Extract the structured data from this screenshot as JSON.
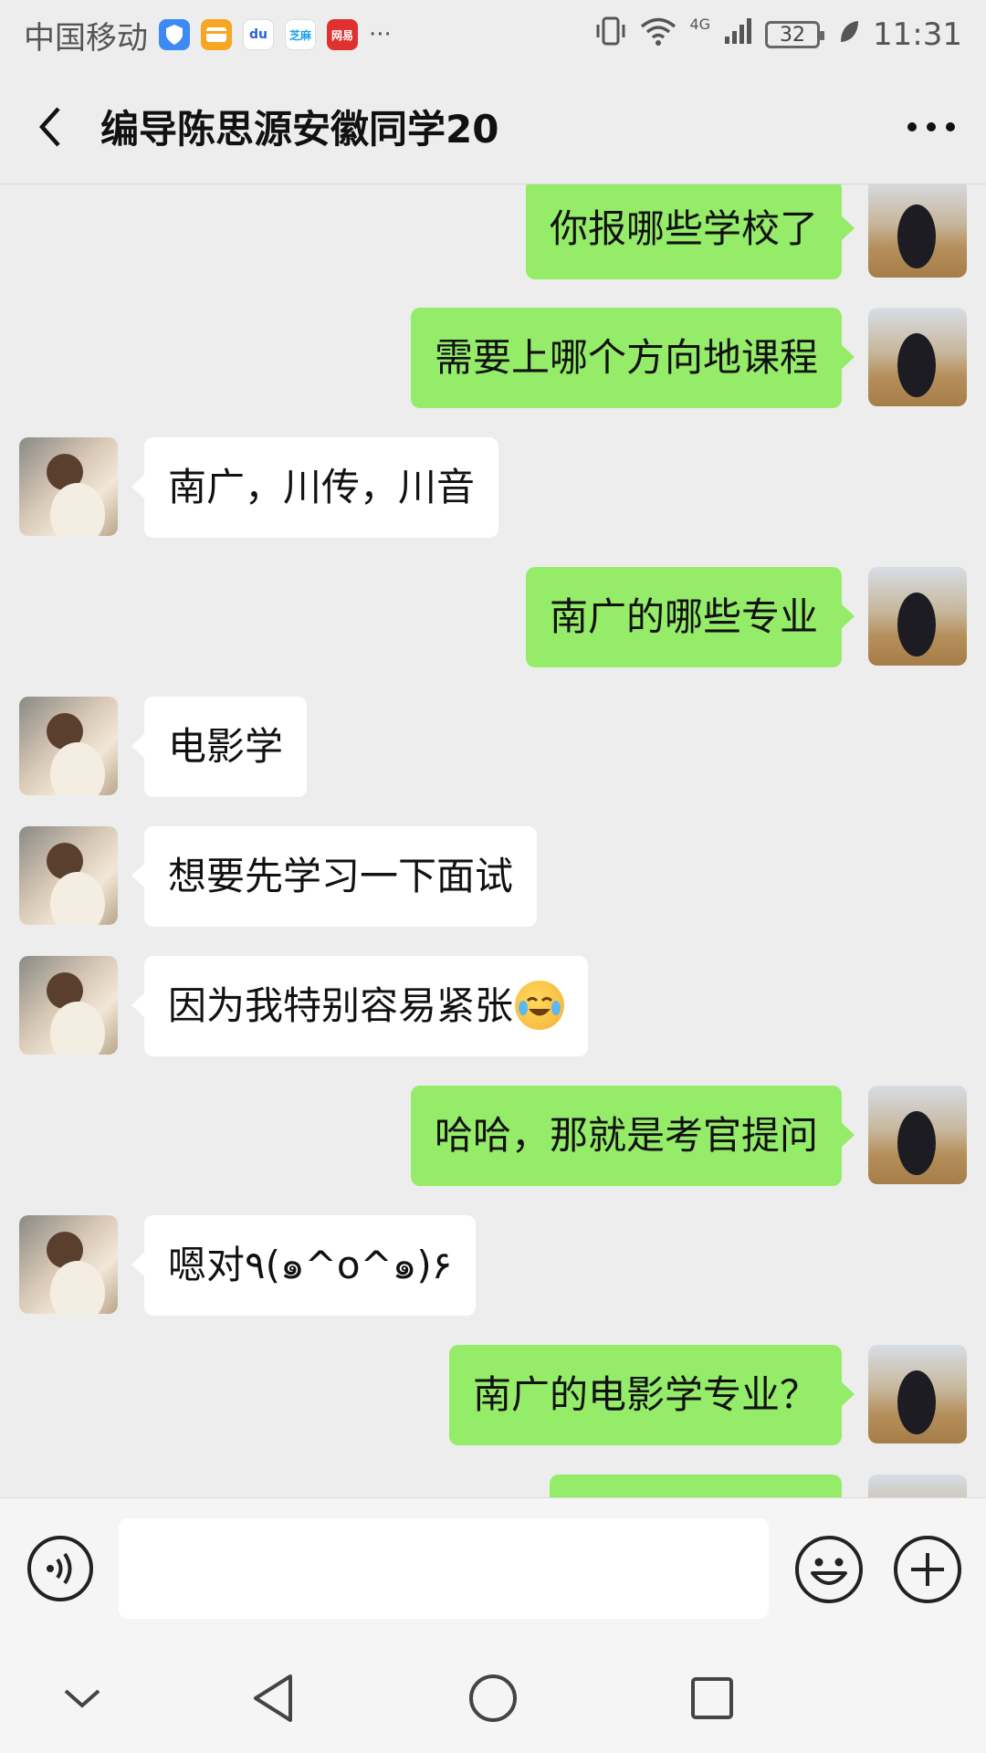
{
  "status_bar": {
    "carrier": "中国移动",
    "apps": [
      {
        "name": "shield-app-icon",
        "color": "#3d8bf2",
        "text": ""
      },
      {
        "name": "card-app-icon",
        "color": "#f6a623",
        "text": ""
      },
      {
        "name": "baidu-app-icon",
        "color": "#ffffff",
        "text": "du"
      },
      {
        "name": "zhima-app-icon",
        "color": "#ffffff",
        "text": "芝麻"
      },
      {
        "name": "netease-app-icon",
        "color": "#e03131",
        "text": "网易"
      }
    ],
    "overflow": "···",
    "network": "4G",
    "battery": "32",
    "time": "11:31"
  },
  "header": {
    "title": "编导陈思源安徽同学20"
  },
  "messages": [
    {
      "side": "right",
      "text": "你报哪些学校了"
    },
    {
      "side": "right",
      "text": "需要上哪个方向地课程"
    },
    {
      "side": "left",
      "text": "南广，川传，川音"
    },
    {
      "side": "right",
      "text": "南广的哪些专业"
    },
    {
      "side": "left",
      "text": "电影学"
    },
    {
      "side": "left",
      "text": "想要先学习一下面试"
    },
    {
      "side": "left",
      "text": "因为我特别容易紧张",
      "emoji": "crying-laughing-emoji"
    },
    {
      "side": "right",
      "text": "哈哈，那就是考官提问"
    },
    {
      "side": "left",
      "text": "嗯对٩(๑^o^๑)۶"
    },
    {
      "side": "right",
      "text": "南广的电影学专业？"
    },
    {
      "side": "right",
      "text": ""
    }
  ],
  "input_bar": {
    "placeholder": ""
  },
  "colors": {
    "background": "#ededed",
    "sent_bubble": "#95ec69",
    "received_bubble": "#ffffff"
  }
}
